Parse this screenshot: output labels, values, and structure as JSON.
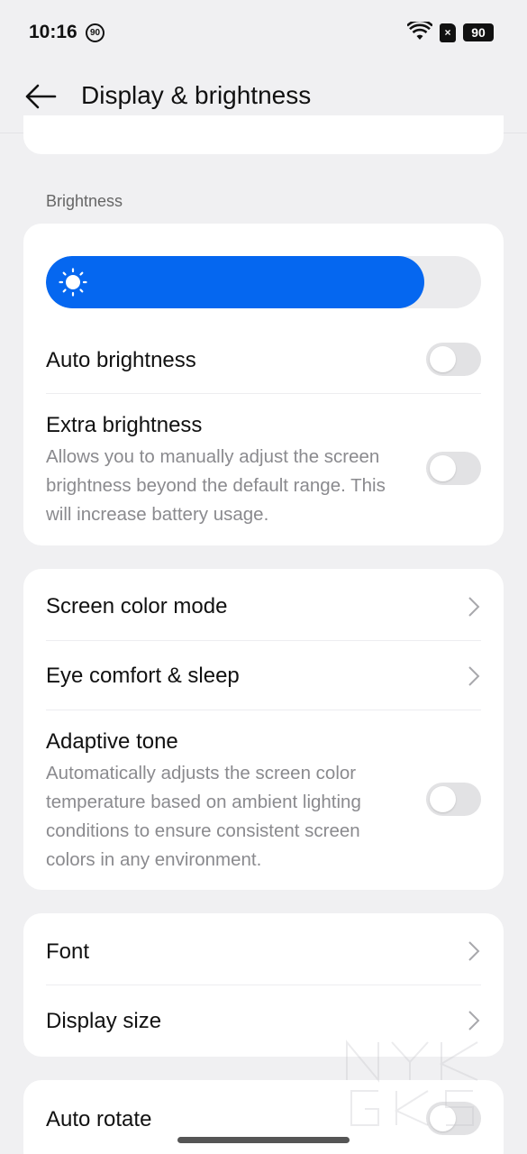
{
  "status_bar": {
    "time": "10:16",
    "notification_badge": "90",
    "sim_indicator": "×",
    "battery_level": "90"
  },
  "header": {
    "title": "Display & brightness",
    "back_icon": "arrow-left-icon"
  },
  "brightness_section": {
    "label": "Brightness",
    "slider_level": 0.87,
    "slider_color": "#0567f0",
    "slider_icon": "sun-icon",
    "auto_brightness": {
      "title": "Auto brightness",
      "enabled": false
    },
    "extra_brightness": {
      "title": "Extra brightness",
      "description": "Allows you to manually adjust the screen brightness beyond the default range. This will increase battery usage.",
      "enabled": false
    }
  },
  "color_section": {
    "screen_color_mode": "Screen color mode",
    "eye_comfort": "Eye comfort & sleep",
    "adaptive_tone": {
      "title": "Adaptive tone",
      "description": "Automatically adjusts the screen color temperature based on ambient lighting conditions to ensure consistent screen colors in any environment.",
      "enabled": false
    }
  },
  "font_section": {
    "font": "Font",
    "display_size": "Display size"
  },
  "rotate_section": {
    "auto_rotate": {
      "title": "Auto rotate",
      "enabled": false
    }
  },
  "watermark_text": "NYKGKS"
}
